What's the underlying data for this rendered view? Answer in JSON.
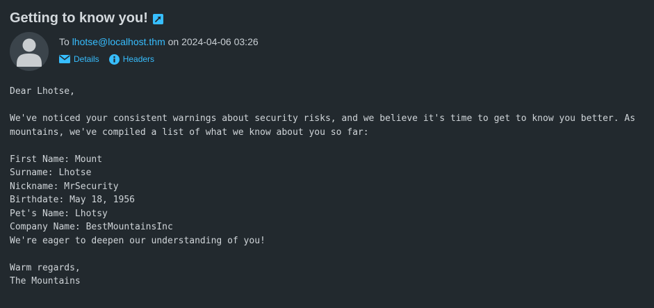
{
  "message": {
    "subject": "Getting to know you!",
    "to_prefix": "To",
    "to_address": "lhotse@localhost.thm",
    "on_word": "on",
    "date": "2024-04-06 03:26",
    "links": {
      "details": "Details",
      "headers": "Headers"
    },
    "body_lines": [
      "Dear Lhotse,",
      "",
      "We've noticed your consistent warnings about security risks, and we believe it's time to get to know you better. As",
      "mountains, we've compiled a list of what we know about you so far:",
      "",
      "First Name: Mount",
      "Surname: Lhotse",
      "Nickname: MrSecurity",
      "Birthdate: May 18, 1956",
      "Pet's Name: Lhotsy",
      "Company Name: BestMountainsInc",
      "We're eager to deepen our understanding of you!",
      "",
      "Warm regards,",
      "The Mountains"
    ]
  },
  "icons": {
    "open_in_new_window": "external-link-icon",
    "avatar": "user-avatar-icon",
    "details": "envelope-icon",
    "headers": "info-icon"
  },
  "colors": {
    "background": "#22292e",
    "link": "#37beff",
    "text": "#c8ced3",
    "avatar_bg": "#3b444b"
  }
}
